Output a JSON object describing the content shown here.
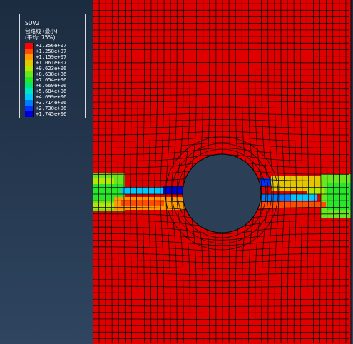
{
  "legend": {
    "variable": "SDV2",
    "section": "包络线 (最小)",
    "average": "(平均: 75%)",
    "entries": [
      {
        "label": "+1.356e+07",
        "color": "#ff0000"
      },
      {
        "label": "+1.258e+07",
        "color": "#ff4c00"
      },
      {
        "label": "+1.159e+07",
        "color": "#ff9b00"
      },
      {
        "label": "+1.061e+07",
        "color": "#e5c700"
      },
      {
        "label": "+9.623e+06",
        "color": "#b4e600"
      },
      {
        "label": "+8.638e+06",
        "color": "#6ae61e"
      },
      {
        "label": "+7.654e+06",
        "color": "#28e628"
      },
      {
        "label": "+6.669e+06",
        "color": "#00e678"
      },
      {
        "label": "+5.684e+06",
        "color": "#00e6c3"
      },
      {
        "label": "+4.699e+06",
        "color": "#00c8ff"
      },
      {
        "label": "+3.714e+06",
        "color": "#007dff"
      },
      {
        "label": "+2.730e+06",
        "color": "#0032ff"
      },
      {
        "label": "+1.745e+06",
        "color": "#0000dc"
      }
    ]
  }
}
